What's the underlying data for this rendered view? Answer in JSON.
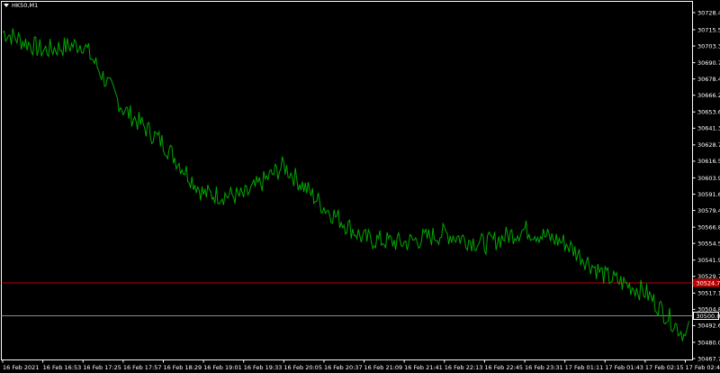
{
  "window": {
    "symbol_label": "HK50,M1"
  },
  "colors": {
    "background": "#000000",
    "line": "#00a800",
    "axis": "#ffffff",
    "current_line": "#c00000",
    "current_bg": "#c00000",
    "level_line": "#8a8a8a"
  },
  "chart_data": {
    "type": "line",
    "title": "HK50,M1",
    "ylim": [
      30467.75,
      30728.45
    ],
    "y_ticks": [
      "30728.45",
      "30715.55",
      "30703.30",
      "30690.70",
      "30678.45",
      "30666.20",
      "30653.60",
      "30641.35",
      "30628.75",
      "30616.50",
      "30603.90",
      "30591.65",
      "30579.40",
      "30566.80",
      "30554.55",
      "30541.95",
      "30529.70",
      "30517.10",
      "30504.85",
      "30492.60",
      "30480.00",
      "30467.75"
    ],
    "x_ticks": [
      "16 Feb 2021",
      "16 Feb 16:53",
      "16 Feb 17:25",
      "16 Feb 17:57",
      "16 Feb 18:29",
      "16 Feb 19:01",
      "16 Feb 19:33",
      "16 Feb 20:05",
      "16 Feb 20:37",
      "16 Feb 21:09",
      "16 Feb 21:41",
      "16 Feb 22:13",
      "16 Feb 22:45",
      "16 Feb 23:31",
      "17 Feb 01:11",
      "17 Feb 01:43",
      "17 Feb 02:15",
      "17 Feb 02:47"
    ],
    "current_price": "30524.75",
    "level_price": "30500.00",
    "series": [
      {
        "x": [
          "16 Feb 2021",
          "16 Feb 16:53",
          "16 Feb 17:25",
          "16 Feb 17:57",
          "16 Feb 18:29",
          "16 Feb 19:01",
          "16 Feb 19:33",
          "16 Feb 20:05",
          "16 Feb 20:37",
          "16 Feb 21:09",
          "16 Feb 21:41",
          "16 Feb 22:13",
          "16 Feb 22:45",
          "16 Feb 23:31",
          "17 Feb 01:11",
          "17 Feb 01:43",
          "17 Feb 02:15",
          "17 Feb 02:47"
        ],
        "values": [
          30714,
          30700,
          30705,
          30656,
          30630,
          30592,
          30590,
          30613,
          30582,
          30558,
          30555,
          30562,
          30554,
          30565,
          30555,
          30530,
          30518,
          30485
        ]
      }
    ]
  }
}
